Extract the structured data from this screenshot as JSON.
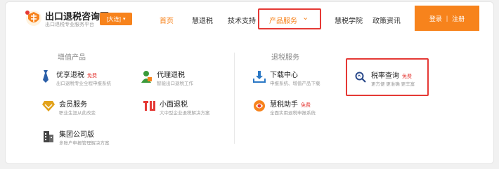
{
  "colors": {
    "accent": "#f7831c",
    "highlight": "#e53935"
  },
  "header": {
    "site_title": "出口退税咨询网",
    "site_subtitle": "出口退税专业服务平台",
    "region_label": "[大连]",
    "nav": {
      "home": "首页",
      "huituishui": "慧退税",
      "tech": "技术支持",
      "products": "产品服务",
      "academy": "慧税学院",
      "policy": "政策资讯"
    },
    "login": "登录",
    "separator": "|",
    "register": "注册"
  },
  "panel": {
    "left_title": "增值产品",
    "right_title": "退税服务",
    "items": [
      {
        "name": "优享退税",
        "badge": "免费",
        "desc": "出口退税专业全程申报系统",
        "icon": "tie-icon"
      },
      {
        "name": "代理退税",
        "badge": "",
        "desc": "智能出口退税工作",
        "icon": "agent-icon"
      },
      {
        "name": "会员服务",
        "badge": "",
        "desc": "职业生涯从此改变",
        "icon": "member-diamond-icon"
      },
      {
        "name": "小面退税",
        "badge": "",
        "desc": "大中型企业退税解决方案",
        "icon": "tu-logo-icon"
      },
      {
        "name": "集团公司版",
        "badge": "",
        "desc": "多账户申报管理解决方案",
        "icon": "building-icon"
      },
      {
        "name": "下载中心",
        "badge": "",
        "desc": "申报系统、增值产品下载",
        "icon": "download-icon"
      },
      {
        "name": "慧税助手",
        "badge": "免费",
        "desc": "全面实用退税申报系统",
        "icon": "assistant-swirl-icon"
      },
      {
        "name": "税率查询",
        "badge": "免费",
        "desc": "更方便 更准确 更丰富",
        "icon": "search-icon"
      }
    ]
  }
}
